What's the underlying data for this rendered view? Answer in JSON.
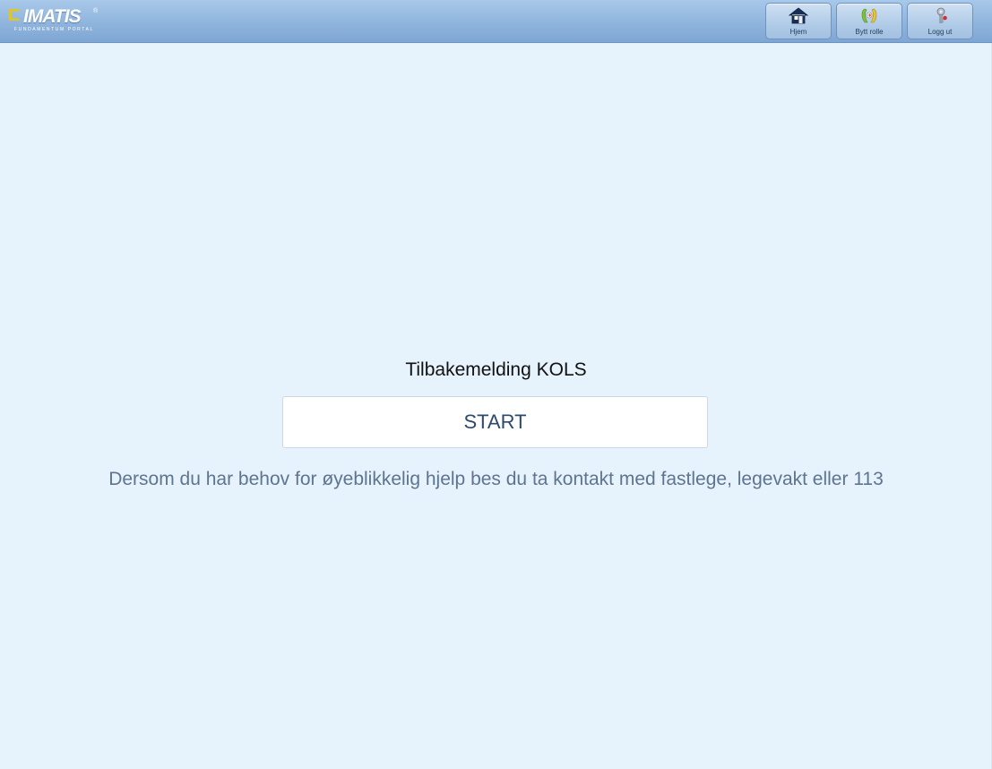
{
  "header": {
    "logo_text": "IMATIS",
    "logo_registered": "®",
    "logo_subtitle": "FUNDAMENTUM PORTAL",
    "buttons": [
      {
        "label": "Hjem",
        "icon": "home-icon"
      },
      {
        "label": "Bytt rolle",
        "icon": "switch-role-icon"
      },
      {
        "label": "Logg ut",
        "icon": "logout-key-icon"
      }
    ]
  },
  "main": {
    "title": "Tilbakemelding KOLS",
    "start_label": "START",
    "notice": "Dersom du har behov for øyeblikkelig hjelp bes du ta kontakt med fastlege, legevakt eller 113"
  },
  "colors": {
    "background": "#e6f3fc",
    "header": "#8fb5de",
    "accent_text": "#2e4a6b",
    "notice_text": "#5f7491"
  }
}
